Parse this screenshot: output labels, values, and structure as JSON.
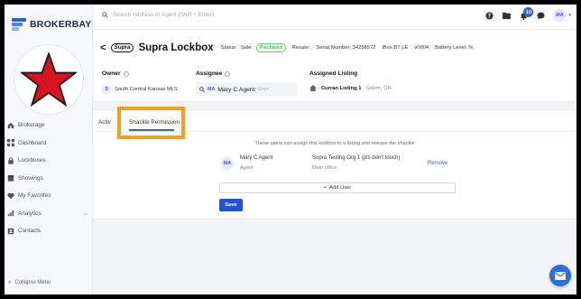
{
  "brand": {
    "name": "BROKERBAY",
    "accent": "#3b5bdb"
  },
  "search": {
    "placeholder": "Search Address or Agent (Shift + Enter)"
  },
  "topbar": {
    "notification_count": "10",
    "user_initials": "MA"
  },
  "sidebar": {
    "items": [
      {
        "label": "Brokerage",
        "icon": "home-icon"
      },
      {
        "label": "Dashboard",
        "icon": "grid-icon"
      },
      {
        "label": "Lockboxes",
        "icon": "lock-icon"
      },
      {
        "label": "Showings",
        "icon": "calendar-icon"
      },
      {
        "label": "My Favorites",
        "icon": "heart-icon"
      },
      {
        "label": "Analytics",
        "icon": "chart-icon"
      },
      {
        "label": "Contacts",
        "icon": "contact-icon"
      }
    ],
    "collapse_label": "Collapse Menu"
  },
  "lockbox": {
    "logo_text": "Supra",
    "title": "Supra Lockbox",
    "status_label": "Status:",
    "sale_label": "Sale:",
    "sale_status": "Purchased",
    "resale_label": "Resale:",
    "serial": "Serial Number: 34258572",
    "model": "iBox BT LE",
    "version": "v0904",
    "battery": "Battery Level: %",
    "owner_label": "Owner",
    "owner_initial": "S",
    "owner_value": "South Central Kansas MLS",
    "assignee_label": "Assignee",
    "assignee_initials": "MA",
    "assignee_name": "Mary C Agent",
    "assignee_tag": "User",
    "listing_label": "Assigned Listing",
    "listing_name": "Curran Listing 1",
    "listing_location": "Salem, OR"
  },
  "tabs": [
    {
      "label": "Activ"
    },
    {
      "label": "Shackle Permission"
    }
  ],
  "permissions": {
    "description": "These users can assign this lockbox to a listing and release the shackle",
    "rows": [
      {
        "initials": "MA",
        "name": "Mary C Agent",
        "role": "Agent",
        "org": "Supra Testing Org 1 (pls don't touch)",
        "office": "Main office",
        "action": "Remove"
      }
    ],
    "add_user_label": "Add User",
    "save_label": "Save"
  }
}
